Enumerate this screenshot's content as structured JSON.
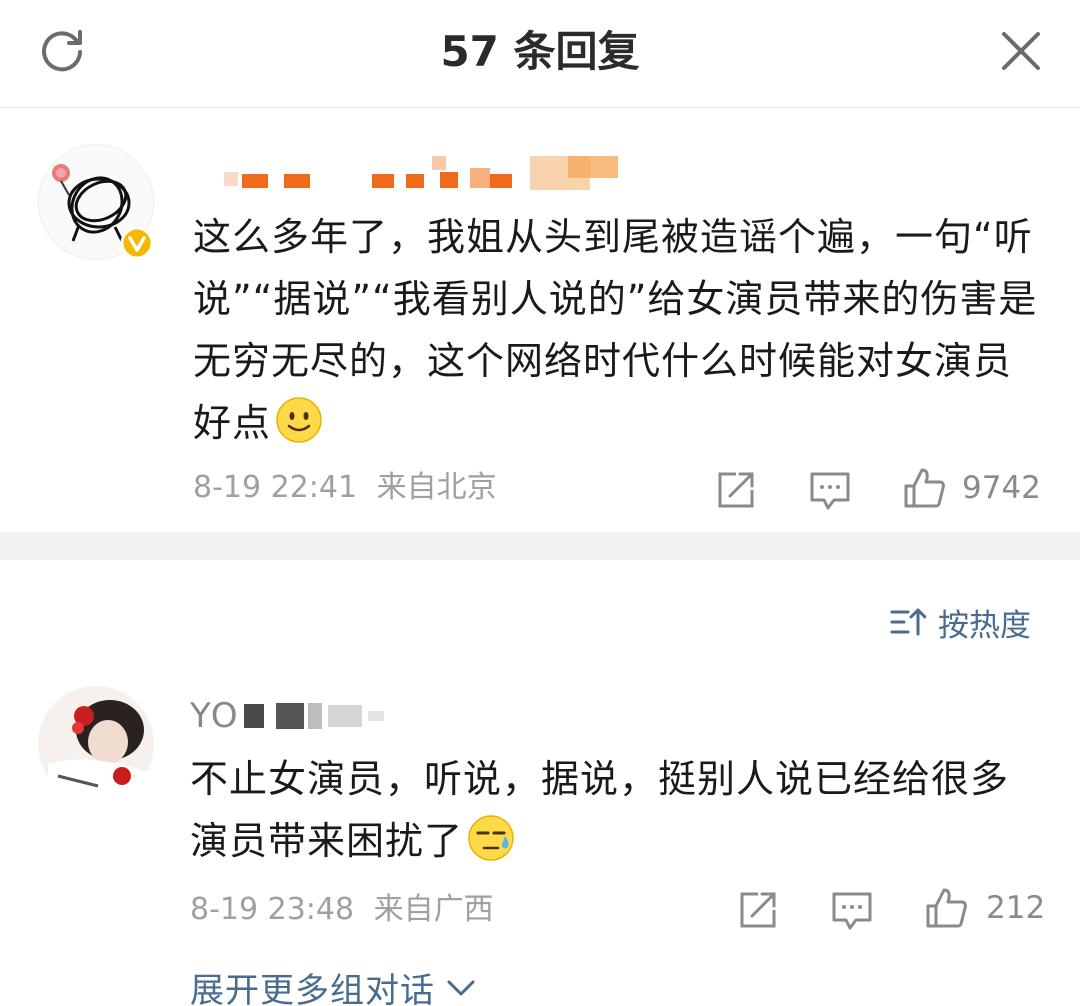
{
  "header": {
    "title": "57 条回复",
    "refresh_icon": "refresh-icon",
    "close_icon": "close-icon"
  },
  "main_comment": {
    "text": "这么多年了，我姐从头到尾被造谣个遍，一句“听说”“据说”“我看别人说的”给女演员带来的伤害是无穷无尽的，这个网络时代什么时候能对女演员好点",
    "emoji": "smile-emoji",
    "timestamp": "8-19 22:41",
    "location": "来自北京",
    "likes": "9742",
    "verified_badge": "verified-badge",
    "badge_color": "#f5b800"
  },
  "sort": {
    "label": "按热度",
    "icon": "sort-icon"
  },
  "reply": {
    "username": "YO",
    "text": "不止女演员，听说，据说，挺别人说已经给很多演员带来困扰了",
    "emoji": "sweat-emoji",
    "timestamp": "8-19 23:48",
    "location": "来自广西",
    "likes": "212"
  },
  "expand": {
    "label": "展开更多组对话",
    "icon": "chevron-down-icon"
  },
  "colors": {
    "link_blue": "#4a6b8f",
    "meta_gray": "#a0a0a0",
    "blur_orange": "#f06a1c"
  }
}
